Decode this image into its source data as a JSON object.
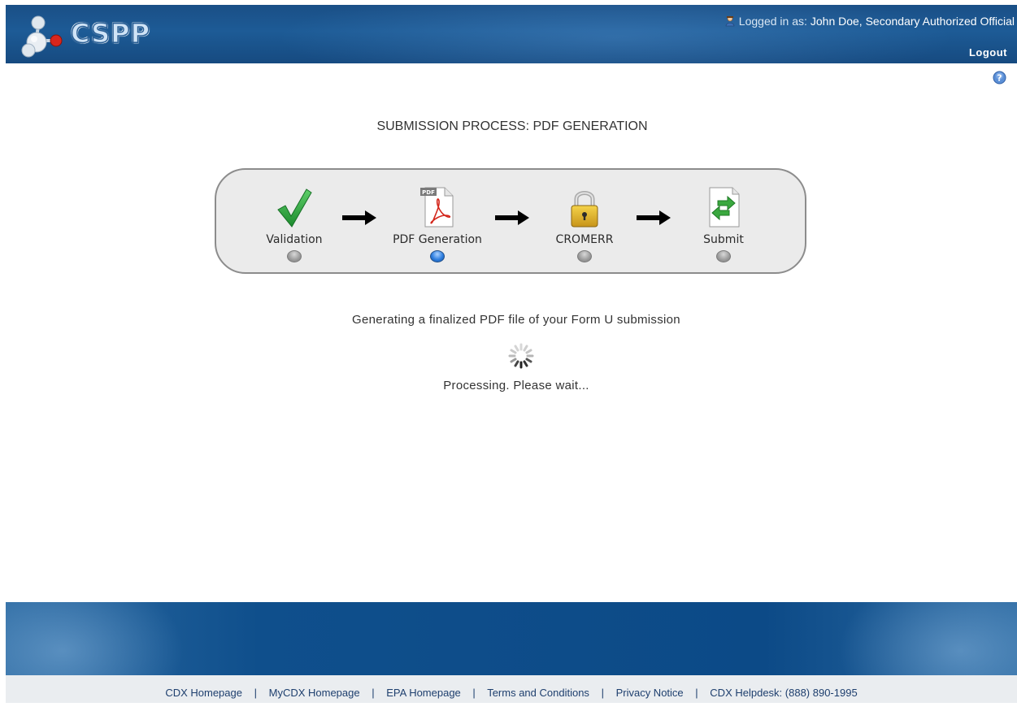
{
  "header": {
    "logo_text": "CSPP",
    "logged_in_label": "Logged in as:",
    "user_name": "John Doe, Secondary Authorized Official",
    "logout_label": "Logout"
  },
  "page_title": "SUBMISSION PROCESS: PDF GENERATION",
  "steps": [
    {
      "label": "Validation",
      "icon": "checkmark-icon",
      "active": false
    },
    {
      "label": "PDF Generation",
      "icon": "pdf-document-icon",
      "active": true
    },
    {
      "label": "CROMERR",
      "icon": "padlock-icon",
      "active": false
    },
    {
      "label": "Submit",
      "icon": "submit-document-icon",
      "active": false
    }
  ],
  "status": {
    "message": "Generating a finalized PDF file of your Form U submission",
    "processing": "Processing. Please wait..."
  },
  "footer": {
    "links": [
      "CDX Homepage",
      "MyCDX Homepage",
      "EPA Homepage",
      "Terms and Conditions",
      "Privacy Notice",
      "CDX Helpdesk: (888) 890-1995"
    ]
  },
  "colors": {
    "header_blue": "#1d5b96",
    "active_step": "#2f7fe0",
    "panel_bg": "#ebebeb"
  }
}
